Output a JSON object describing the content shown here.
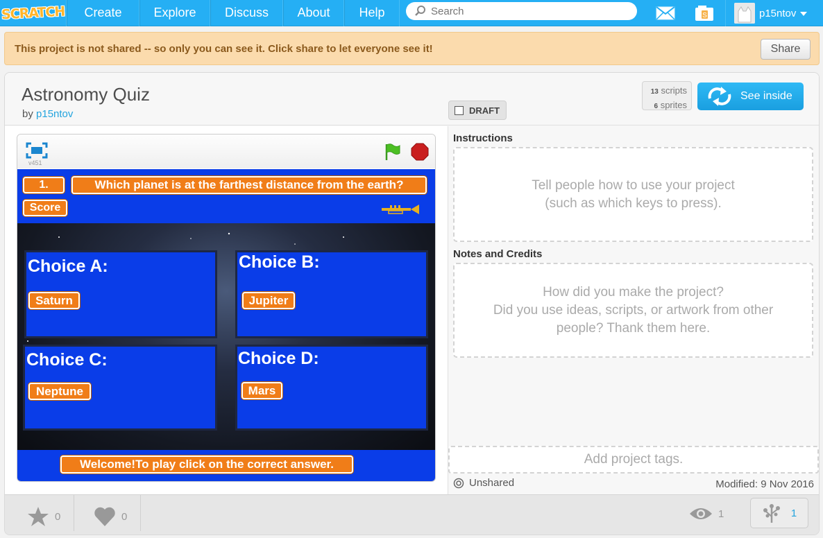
{
  "nav": {
    "logo": "SCRATCH",
    "items": [
      "Create",
      "Explore",
      "Discuss",
      "About",
      "Help"
    ],
    "search_placeholder": "Search",
    "username": "p15ntov"
  },
  "banner": {
    "message": "This project is not shared -- so only you can see it. Click share to let everyone see it!",
    "share_label": "Share"
  },
  "project": {
    "title": "Astronomy Quiz",
    "by": "by",
    "author": "p15ntov",
    "draft_label": "DRAFT",
    "scripts_count": "13",
    "scripts_label": "scripts",
    "sprites_count": "6",
    "sprites_label": "sprites",
    "see_inside_label": "See inside"
  },
  "player": {
    "version": "v451",
    "question_number": "1.",
    "question": "Which planet is at the farthest distance from the earth?",
    "score_label": "Score",
    "choices": [
      {
        "label": "Choice A:",
        "answer": "Saturn"
      },
      {
        "label": "Choice B:",
        "answer": "Jupiter"
      },
      {
        "label": "Choice C:",
        "answer": "Neptune"
      },
      {
        "label": "Choice D:",
        "answer": "Mars"
      }
    ],
    "welcome": "Welcome!To play click on the correct answer."
  },
  "details": {
    "instructions_title": "Instructions",
    "instructions_placeholder_1": "Tell people how to use your project",
    "instructions_placeholder_2": "(such as which keys to press).",
    "notes_title": "Notes and Credits",
    "notes_placeholder_1": "How did you make the project?",
    "notes_placeholder_2": "Did you use ideas, scripts, or artwork from other",
    "notes_placeholder_3": "people? Thank them here.",
    "tags_placeholder": "Add project tags.",
    "status": "Unshared",
    "modified": "Modified: 9 Nov 2016"
  },
  "footer": {
    "favorites": "0",
    "loves": "0",
    "views": "1",
    "remixes": "1"
  },
  "colors": {
    "nav_bg": "#25aff4",
    "stage_blue": "#0a3de8",
    "pill_orange": "#f07d18",
    "banner_bg": "#fbdbad"
  }
}
